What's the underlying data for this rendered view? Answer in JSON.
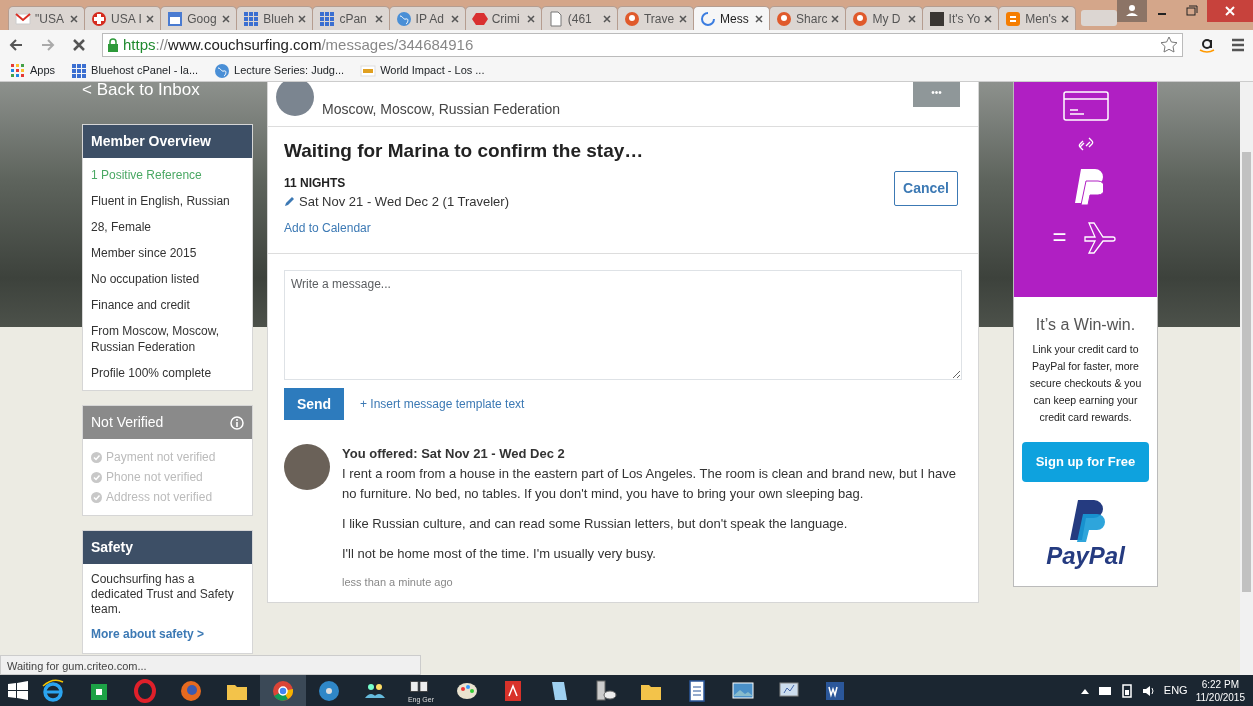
{
  "browser": {
    "tabs": [
      {
        "label": "\"USA",
        "kind": "mail",
        "selected": false
      },
      {
        "label": "USA I",
        "kind": "cross",
        "selected": false
      },
      {
        "label": "Goog",
        "kind": "calendar",
        "selected": false
      },
      {
        "label": "Blueh",
        "kind": "grid",
        "selected": false
      },
      {
        "label": "cPan",
        "kind": "grid",
        "selected": false
      },
      {
        "label": "IP Ad",
        "kind": "globe",
        "selected": false
      },
      {
        "label": "Crimi",
        "kind": "hexagon",
        "selected": false
      },
      {
        "label": "(461",
        "kind": "document",
        "selected": false
      },
      {
        "label": "Trave",
        "kind": "badge",
        "selected": false
      },
      {
        "label": "Mess",
        "kind": "spinner",
        "selected": true
      },
      {
        "label": "Sharc",
        "kind": "badge",
        "selected": false
      },
      {
        "label": "My D",
        "kind": "badge",
        "selected": false
      },
      {
        "label": "It's Yo",
        "kind": "square",
        "selected": false
      },
      {
        "label": "Men's",
        "kind": "blog",
        "selected": false
      }
    ],
    "url": {
      "scheme": "https",
      "sep": "://",
      "host": "www.couchsurfing.com",
      "path": "/messages/344684916"
    },
    "bookmarks": [
      {
        "label": "Apps",
        "kind": "apps"
      },
      {
        "label": "Bluehost cPanel - la...",
        "kind": "grid"
      },
      {
        "label": "Lecture Series: Judg...",
        "kind": "globe"
      },
      {
        "label": "World Impact - Los ...",
        "kind": "wi"
      }
    ]
  },
  "page": {
    "back_link": "< Back to Inbox",
    "member_overview": {
      "title": "Member Overview",
      "items": [
        {
          "text": "1 Positive Reference",
          "kind": "positive"
        },
        {
          "text": "Fluent in English, Russian",
          "kind": "plain"
        },
        {
          "text": "28, Female",
          "kind": "plain"
        },
        {
          "text": "Member since 2015",
          "kind": "plain"
        },
        {
          "text": "No occupation listed",
          "kind": "plain"
        },
        {
          "text": "Finance and credit",
          "kind": "plain"
        },
        {
          "text": "From Moscow, Moscow, Russian Federation",
          "kind": "plain"
        },
        {
          "text": "Profile 100% complete",
          "kind": "plain"
        }
      ]
    },
    "verification": {
      "title": "Not Verified",
      "items": [
        {
          "text": "Payment not verified",
          "verified": false
        },
        {
          "text": "Phone not verified",
          "verified": false
        },
        {
          "text": "Address not verified",
          "verified": false
        }
      ]
    },
    "safety": {
      "title": "Safety",
      "text": "Couchsurfing has a dedicated Trust and Safety team.",
      "link": "More about safety >"
    },
    "conversation": {
      "location": "Moscow, Moscow, Russian Federation",
      "more_button": "•••",
      "status_title": "Waiting for Marina to confirm the stay…",
      "nights": "11 NIGHTS",
      "dates": "Sat Nov 21 - Wed Dec 2 (1 Traveler)",
      "calendar_link": "Add to Calendar",
      "cancel_button": "Cancel",
      "message_placeholder": "Write a message...",
      "send_button": "Send",
      "template_link": "+ Insert message template text",
      "message": {
        "heading": "You offered: Sat Nov 21 - Wed Dec 2",
        "paragraphs": [
          "I rent a room from a house in the eastern part of Los Angeles. The room is clean and brand new, but I have no furniture. No bed, no tables. If you don't mind, you have to bring your own sleeping bag.",
          "I like Russian culture, and can read some Russian letters, but don't speak the language.",
          "I'll not be home most of the time. I'm usually very busy."
        ],
        "time": "less than a minute ago"
      }
    },
    "ad": {
      "equals": "=",
      "headline": "It’s a Win-win.",
      "body": "Link your credit card to PayPal for faster, more secure checkouts & you can keep earning your credit card rewards.",
      "button": "Sign up for Free",
      "logo": "PayPal"
    }
  },
  "status_bar": "Waiting for gum.criteo.com...",
  "taskbar": {
    "apps": [
      {
        "kind": "ie"
      },
      {
        "kind": "store"
      },
      {
        "kind": "opera"
      },
      {
        "kind": "firefox"
      },
      {
        "kind": "folder"
      },
      {
        "kind": "chrome"
      },
      {
        "kind": "disc"
      },
      {
        "kind": "people"
      },
      {
        "kind": "book",
        "caption": "Eng Ger"
      },
      {
        "kind": "paint"
      },
      {
        "kind": "pdf"
      },
      {
        "kind": "notebook"
      },
      {
        "kind": "phone"
      },
      {
        "kind": "folder"
      },
      {
        "kind": "doc"
      },
      {
        "kind": "photo"
      },
      {
        "kind": "monitor"
      },
      {
        "kind": "word"
      }
    ],
    "language": "ENG",
    "time": "6:22 PM",
    "date": "11/20/2015"
  }
}
